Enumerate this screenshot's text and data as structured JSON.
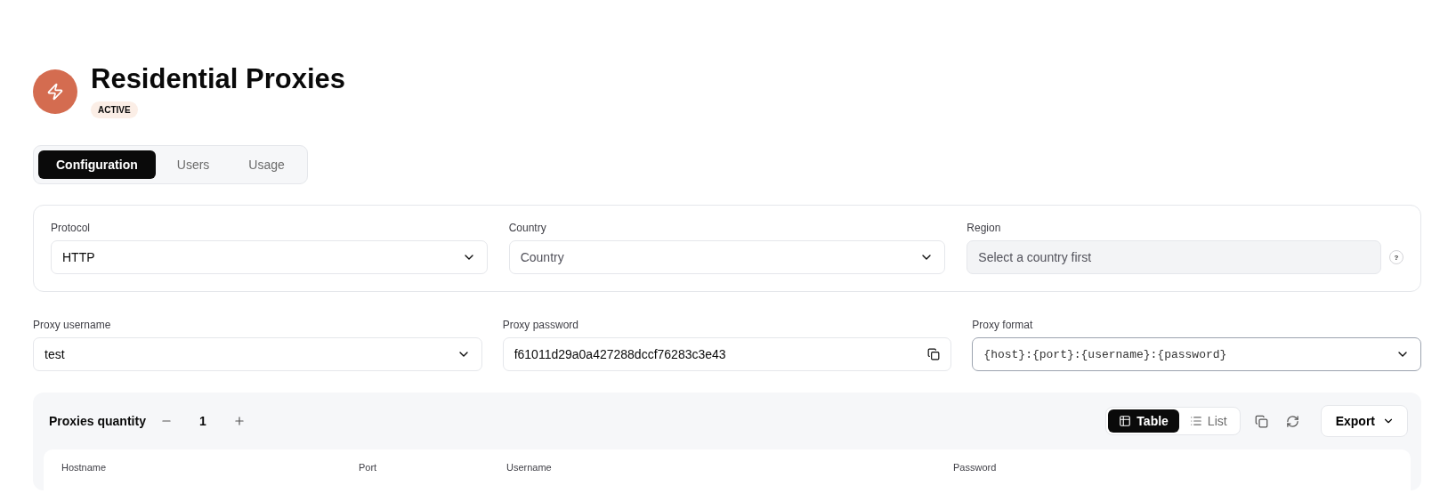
{
  "header": {
    "title": "Residential Proxies",
    "status": "ACTIVE"
  },
  "tabs": [
    {
      "label": "Configuration",
      "selected": true
    },
    {
      "label": "Users",
      "selected": false
    },
    {
      "label": "Usage",
      "selected": false
    }
  ],
  "filters": [
    {
      "label": "Protocol",
      "value": "HTTP",
      "disabled": false
    },
    {
      "label": "Country",
      "placeholder": "Country",
      "disabled": false
    },
    {
      "label": "Region",
      "placeholder": "Select a country first",
      "disabled": true,
      "help_mark": "?"
    }
  ],
  "credentials": [
    {
      "kind": "select",
      "label": "Proxy username",
      "value": "test"
    },
    {
      "kind": "copy",
      "label": "Proxy password",
      "value": "f61011d29a0a427288dccf76283c3e43"
    },
    {
      "kind": "format",
      "label": "Proxy format",
      "value": "{host}:{port}:{username}:{password}"
    }
  ],
  "quantity": {
    "label": "Proxies quantity",
    "value": "1"
  },
  "view_modes": [
    {
      "kind": "table",
      "label": "Table",
      "selected": true
    },
    {
      "kind": "list",
      "label": "List",
      "selected": false
    }
  ],
  "export_label": "Export",
  "table": {
    "columns": [
      "Hostname",
      "Port",
      "Username",
      "Password"
    ]
  }
}
